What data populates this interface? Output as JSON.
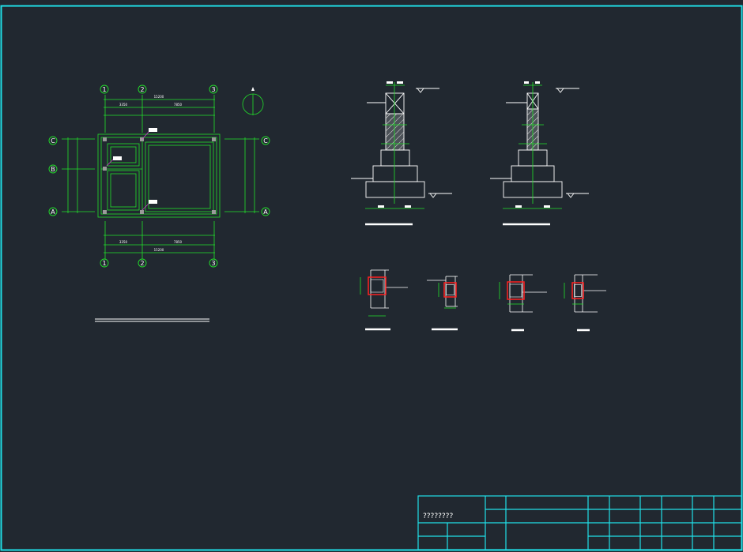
{
  "drawing": {
    "background_color": "#212830",
    "frame_color": "#20e0e8",
    "line_green": "#22e02a",
    "line_red": "#ff2020",
    "hatch_color": "#cfcfcf"
  },
  "plan": {
    "grid_top": [
      "1",
      "2",
      "3"
    ],
    "grid_bottom": [
      "1",
      "2",
      "3"
    ],
    "grid_left": [
      "C",
      "B",
      "A"
    ],
    "grid_right": [
      "C",
      "A"
    ],
    "dims_top": {
      "total": "15200",
      "span1": "3350",
      "span2": "7850"
    },
    "dims_bottom": {
      "total": "15200",
      "span1": "3350",
      "span2": "7850"
    }
  },
  "title_block": {
    "project_name": "????????"
  }
}
